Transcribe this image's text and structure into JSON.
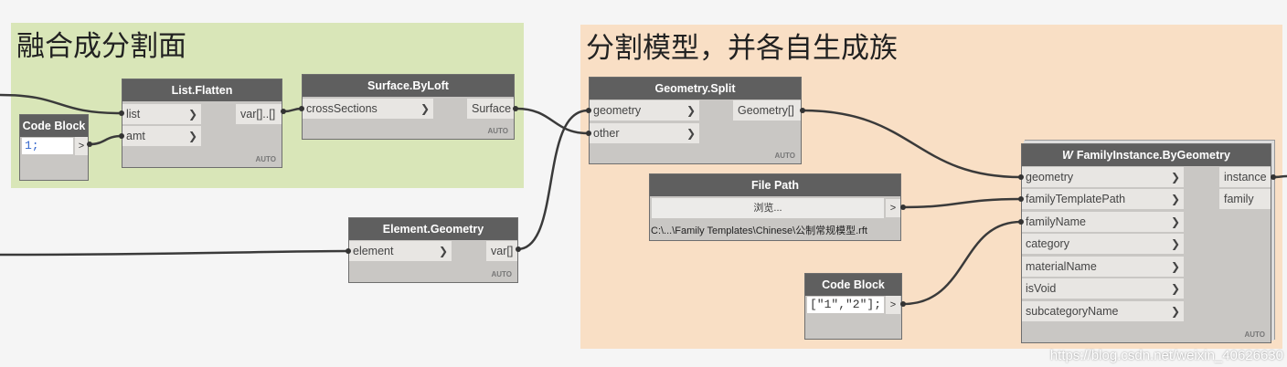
{
  "groups": {
    "g1": {
      "title": "融合成分割面",
      "color": "#d9e6b8"
    },
    "g2": {
      "title": "分割模型，并各自生成族",
      "color": "#f9dfc5"
    }
  },
  "nodes": {
    "code_block_1": {
      "title": "Code Block",
      "code": "1;",
      "out": ">"
    },
    "list_flatten": {
      "title": "List.Flatten",
      "in1": "list",
      "in2": "amt",
      "out": "var[]..[]",
      "auto": "AUTO"
    },
    "surface_byloft": {
      "title": "Surface.ByLoft",
      "in1": "crossSections",
      "out": "Surface",
      "auto": "AUTO"
    },
    "element_geometry": {
      "title": "Element.Geometry",
      "in1": "element",
      "out": "var[]",
      "auto": "AUTO"
    },
    "geometry_split": {
      "title": "Geometry.Split",
      "in1": "geometry",
      "in2": "other",
      "out": "Geometry[]",
      "auto": "AUTO"
    },
    "file_path": {
      "title": "File Path",
      "browse": "浏览...",
      "out": ">",
      "path": "C:\\...\\Family Templates\\Chinese\\公制常规模型.rft"
    },
    "code_block_2": {
      "title": "Code Block",
      "code": "[\"1\",\"2\"];",
      "out": ">"
    },
    "family_instance": {
      "title": "FamilyInstance.ByGeometry",
      "inputs": [
        "geometry",
        "familyTemplatePath",
        "familyName",
        "category",
        "materialName",
        "isVoid",
        "subcategoryName"
      ],
      "out1": "instance",
      "out2": "family",
      "auto": "AUTO"
    }
  },
  "watermark": "https://blog.csdn.net/weixin_40626630"
}
